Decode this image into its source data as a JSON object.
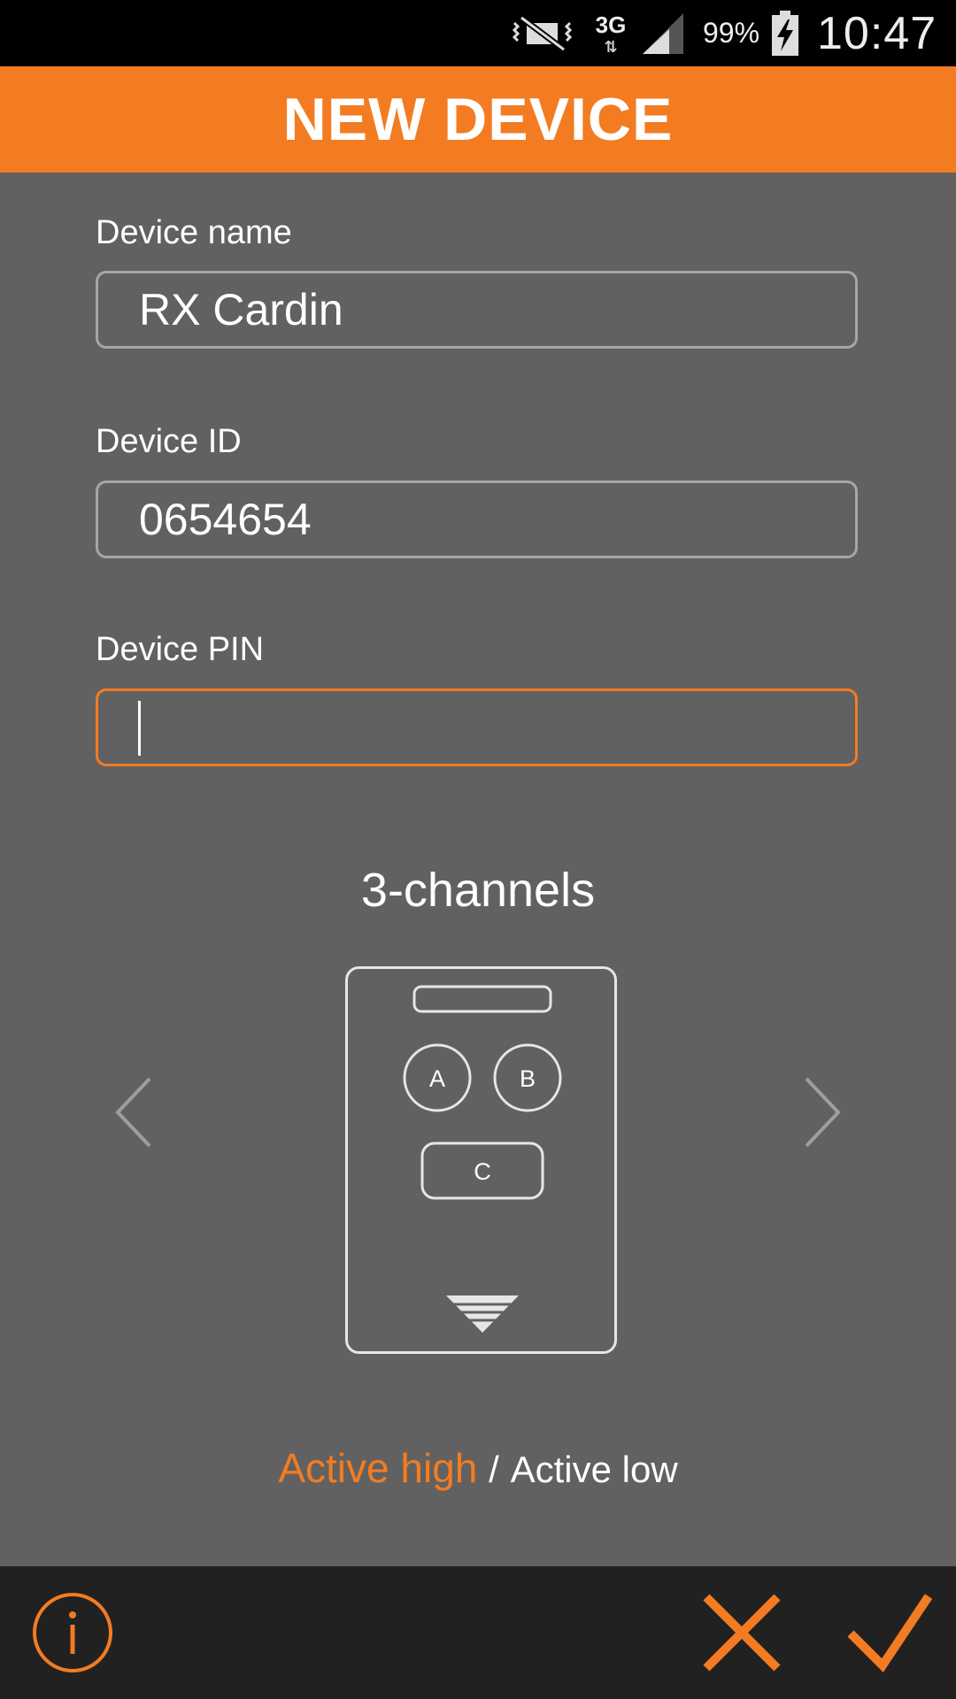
{
  "status_bar": {
    "network": "3G",
    "battery_percent": "99%",
    "time": "10:47",
    "icons": [
      "vibrate-mute-icon",
      "network-arrows-icon",
      "signal-icon",
      "battery-charging-icon"
    ]
  },
  "header": {
    "title": "NEW DEVICE"
  },
  "form": {
    "device_name": {
      "label": "Device name",
      "value": "RX Cardin"
    },
    "device_id": {
      "label": "Device ID",
      "value": "0654654"
    },
    "device_pin": {
      "label": "Device PIN",
      "value": ""
    }
  },
  "channels": {
    "title": "3-channels",
    "buttons": [
      "A",
      "B",
      "C"
    ]
  },
  "mode": {
    "active": "Active high",
    "separator": "/",
    "inactive": "Active low"
  },
  "bottom_bar": {
    "icons": [
      "info-icon",
      "cancel-icon",
      "confirm-icon"
    ]
  },
  "colors": {
    "accent": "#f37c22",
    "background": "#616161",
    "bottom_bar": "#212121"
  }
}
